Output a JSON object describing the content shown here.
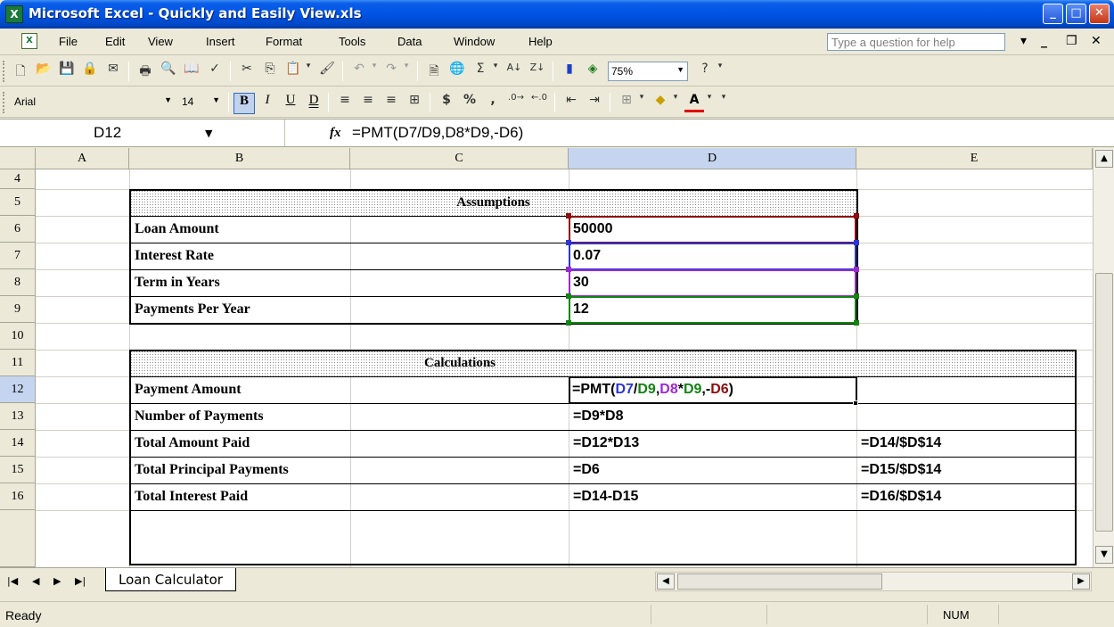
{
  "window": {
    "title": "Microsoft Excel - Quickly and Easily View.xls"
  },
  "menu": {
    "items": [
      "File",
      "Edit",
      "View",
      "Insert",
      "Format",
      "Tools",
      "Data",
      "Window",
      "Help"
    ],
    "help_placeholder": "Type a question for help"
  },
  "toolbar": {
    "zoom": "75%",
    "font_name": "Arial",
    "font_size": "14"
  },
  "formula_bar": {
    "name_box": "D12",
    "fx_label": "fx",
    "formula": "=PMT(D7/D9,D8*D9,-D6)"
  },
  "grid": {
    "columns": [
      "A",
      "B",
      "C",
      "D",
      "E"
    ],
    "rows": [
      "4",
      "5",
      "6",
      "7",
      "8",
      "9",
      "10",
      "11",
      "12",
      "13",
      "14",
      "15",
      "16"
    ],
    "selected_column": "D",
    "selected_row": "12"
  },
  "assumptions": {
    "title": "Assumptions",
    "rows": [
      {
        "label": "Loan Amount",
        "value": "50000"
      },
      {
        "label": "Interest Rate",
        "value": "0.07"
      },
      {
        "label": "Term in Years",
        "value": "30"
      },
      {
        "label": "Payments Per Year",
        "value": "12"
      }
    ]
  },
  "calculations": {
    "title": "Calculations",
    "payment_amount_label": "Payment Amount",
    "payment_formula_parts": {
      "p1": "=PMT(",
      "p2": "D7",
      "p3": "/",
      "p4": "D9",
      "p5": ",",
      "p6": "D8",
      "p7": "*",
      "p8": "D9",
      "p9": ",-",
      "p10": "D6",
      "p11": ")"
    },
    "rows": [
      {
        "label": "Number of Payments",
        "d": "=D9*D8",
        "e": ""
      },
      {
        "label": "Total Amount Paid",
        "d": "=D12*D13",
        "e": "=D14/$D$14"
      },
      {
        "label": "Total Principal Payments",
        "d": "=D6",
        "e": "=D15/$D$14"
      },
      {
        "label": "Total Interest Paid",
        "d": "=D14-D15",
        "e": "=D16/$D$14"
      }
    ]
  },
  "sheet_tabs": {
    "active": "Loan Calculator"
  },
  "status": {
    "mode": "Ready",
    "num": "NUM"
  },
  "colors": {
    "ref_blue": "#2b34d9",
    "ref_green": "#138413",
    "ref_purple": "#9b2ad1",
    "ref_red": "#8e0e0e"
  }
}
